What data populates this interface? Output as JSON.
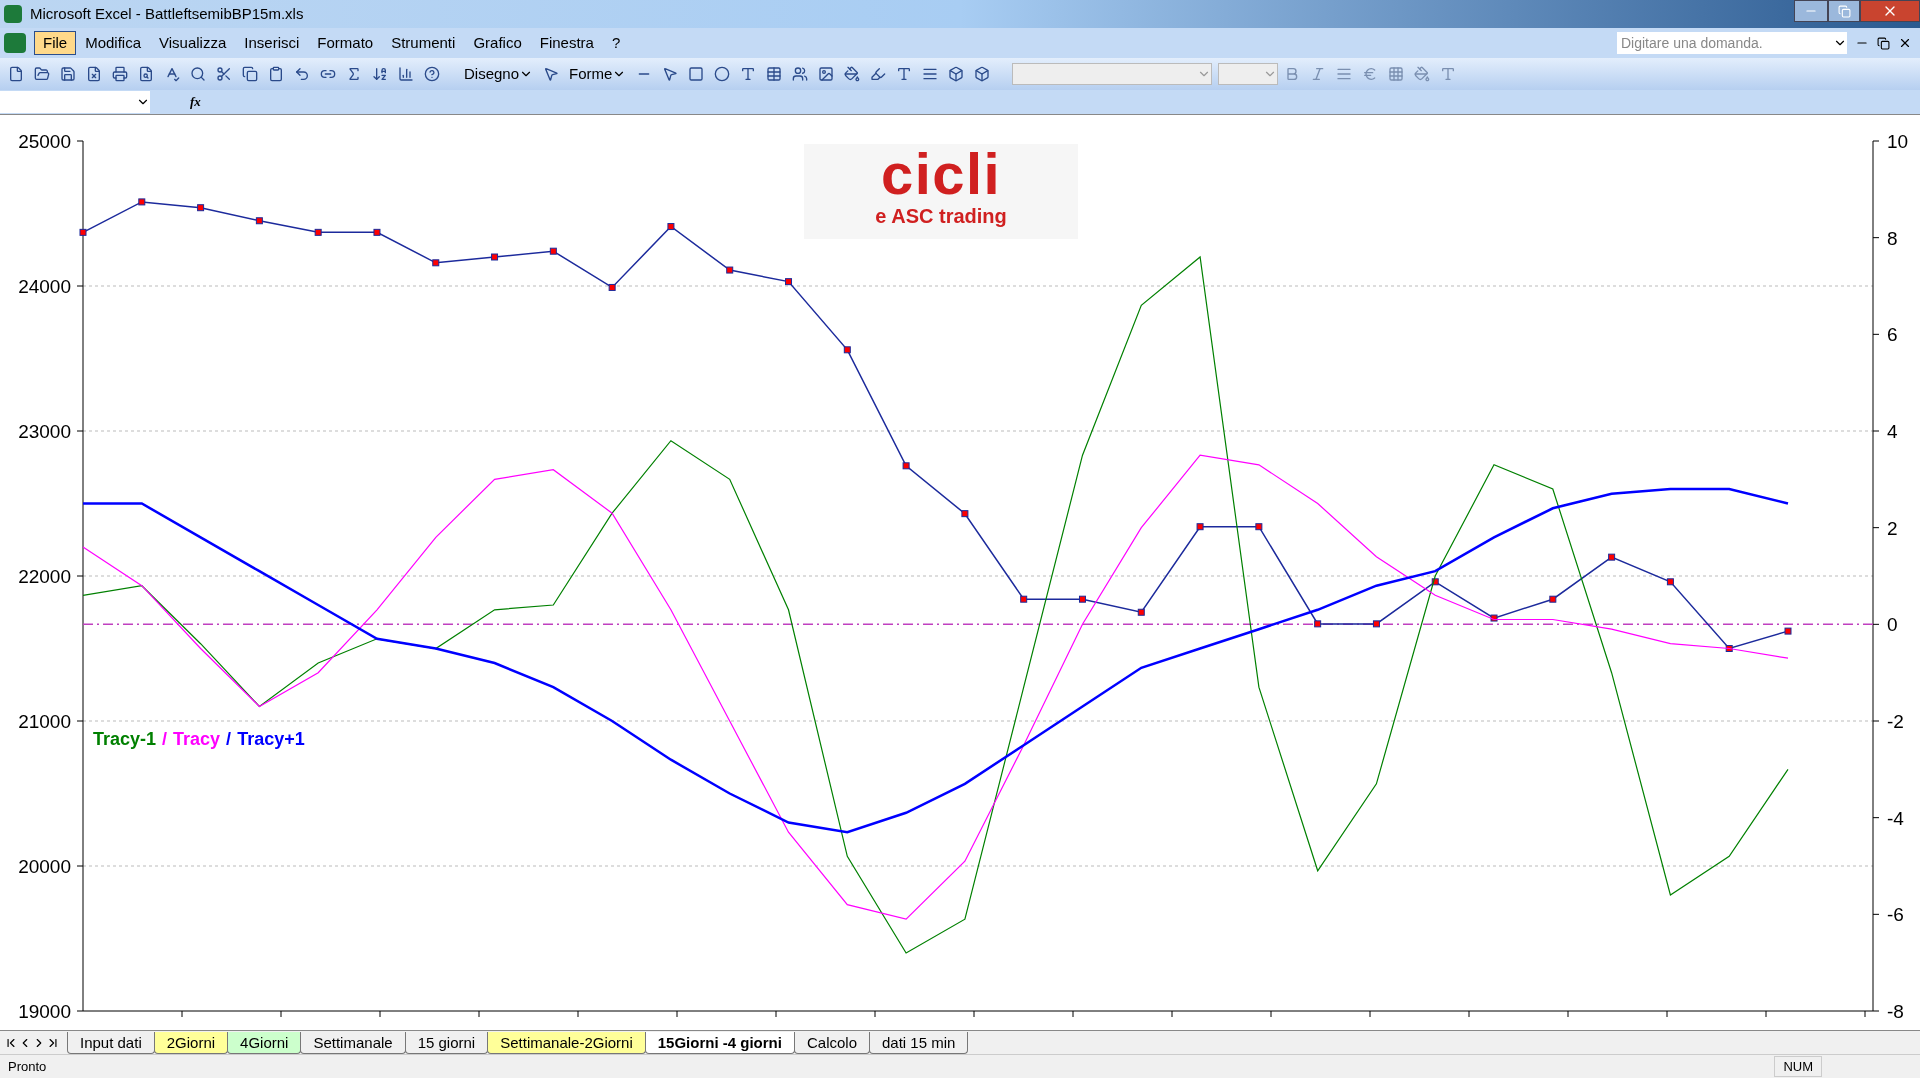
{
  "window": {
    "title": "Microsoft Excel - BattleftsemibBP15m.xls"
  },
  "menu": [
    {
      "label": "File",
      "selected": true
    },
    {
      "label": "Modifica",
      "selected": false
    },
    {
      "label": "Visualizza",
      "selected": false
    },
    {
      "label": "Inserisci",
      "selected": false
    },
    {
      "label": "Formato",
      "selected": false
    },
    {
      "label": "Strumenti",
      "selected": false
    },
    {
      "label": "Grafico",
      "selected": false
    },
    {
      "label": "Finestra",
      "selected": false
    },
    {
      "label": "?",
      "selected": false
    }
  ],
  "help_search": {
    "placeholder": "Digitare una domanda."
  },
  "drawing_toolbar": {
    "draw_label": "Disegno",
    "shapes_label": "Forme"
  },
  "formula_bar": {
    "function_label": "fx"
  },
  "chart": {
    "logo": {
      "title": "cicli",
      "subtitle": "e ASC trading"
    },
    "legend_separator": "/",
    "chart_data": {
      "type": "line",
      "grid": true,
      "ref_lines": [
        {
          "axis": "y2",
          "value": 0,
          "color": "#c040c0"
        }
      ],
      "ylim": [
        19000,
        25000
      ],
      "yticks": [
        19000,
        20000,
        21000,
        22000,
        23000,
        24000,
        25000
      ],
      "y2lim": [
        -8,
        10
      ],
      "y2ticks": [
        10,
        8,
        6,
        4,
        2,
        0,
        -2,
        -4,
        -6,
        -8
      ],
      "series": [
        {
          "color": "#ff0000",
          "marker": "square",
          "values": [
            24370,
            24580,
            24540,
            24450,
            24370,
            24370,
            24160,
            24200,
            24240,
            23990,
            24410,
            24110,
            24030,
            23560,
            22760,
            22430,
            21840,
            21840,
            21750,
            22340,
            22340,
            21670,
            21670,
            21960,
            21710,
            21840,
            22130,
            21960,
            21500,
            21620
          ]
        },
        {
          "name": "Tracy-1",
          "color": "#008000",
          "axis": "y2",
          "values": [
            0.6,
            0.8,
            -0.4,
            -1.7,
            -0.8,
            -0.3,
            -0.5,
            0.3,
            0.4,
            2.3,
            3.8,
            3.0,
            0.3,
            -4.8,
            -6.8,
            -6.1,
            -1.3,
            3.5,
            6.6,
            7.6,
            -1.3,
            -5.1,
            -3.3,
            1.0,
            3.3,
            2.8,
            -1.0,
            -5.6,
            -4.8,
            -3.0
          ]
        },
        {
          "name": "Tracy",
          "color": "#ff00ff",
          "axis": "y2",
          "values": [
            1.6,
            0.8,
            -0.5,
            -1.7,
            -1.0,
            0.3,
            1.8,
            3.0,
            3.2,
            2.3,
            0.3,
            -2.0,
            -4.3,
            -5.8,
            -6.1,
            -4.9,
            -2.5,
            0,
            2.0,
            3.5,
            3.3,
            2.5,
            1.4,
            0.6,
            0.1,
            0.1,
            -0.1,
            -0.4,
            -0.5,
            -0.7
          ]
        },
        {
          "name": "Tracy+1",
          "color": "#0000ff",
          "axis": "y2",
          "values": [
            2.5,
            2.5,
            1.8,
            1.1,
            0.4,
            -0.3,
            -0.5,
            -0.8,
            -1.3,
            -2.0,
            -2.8,
            -3.5,
            -4.1,
            -4.3,
            -3.9,
            -3.3,
            -2.5,
            -1.7,
            -0.9,
            -0.5,
            -0.1,
            0.3,
            0.8,
            1.1,
            1.8,
            2.4,
            2.7,
            2.8,
            2.8,
            2.5
          ]
        }
      ]
    }
  },
  "sheet_tabs": [
    {
      "label": "Input dati",
      "selected": false
    },
    {
      "label": "2Giorni",
      "selected": false,
      "color": "#ffff99"
    },
    {
      "label": "4Giorni",
      "selected": false,
      "color": "#ccffcc"
    },
    {
      "label": "Settimanale",
      "selected": false
    },
    {
      "label": "15 giorni",
      "selected": false
    },
    {
      "label": "Settimanale-2Giorni",
      "selected": false,
      "color": "#ffff99"
    },
    {
      "label": "15Giorni -4 giorni",
      "selected": true
    },
    {
      "label": "Calcolo",
      "selected": false
    },
    {
      "label": "dati 15 min",
      "selected": false
    }
  ],
  "status_bar": {
    "status": "Pronto",
    "num_lock": "NUM"
  }
}
